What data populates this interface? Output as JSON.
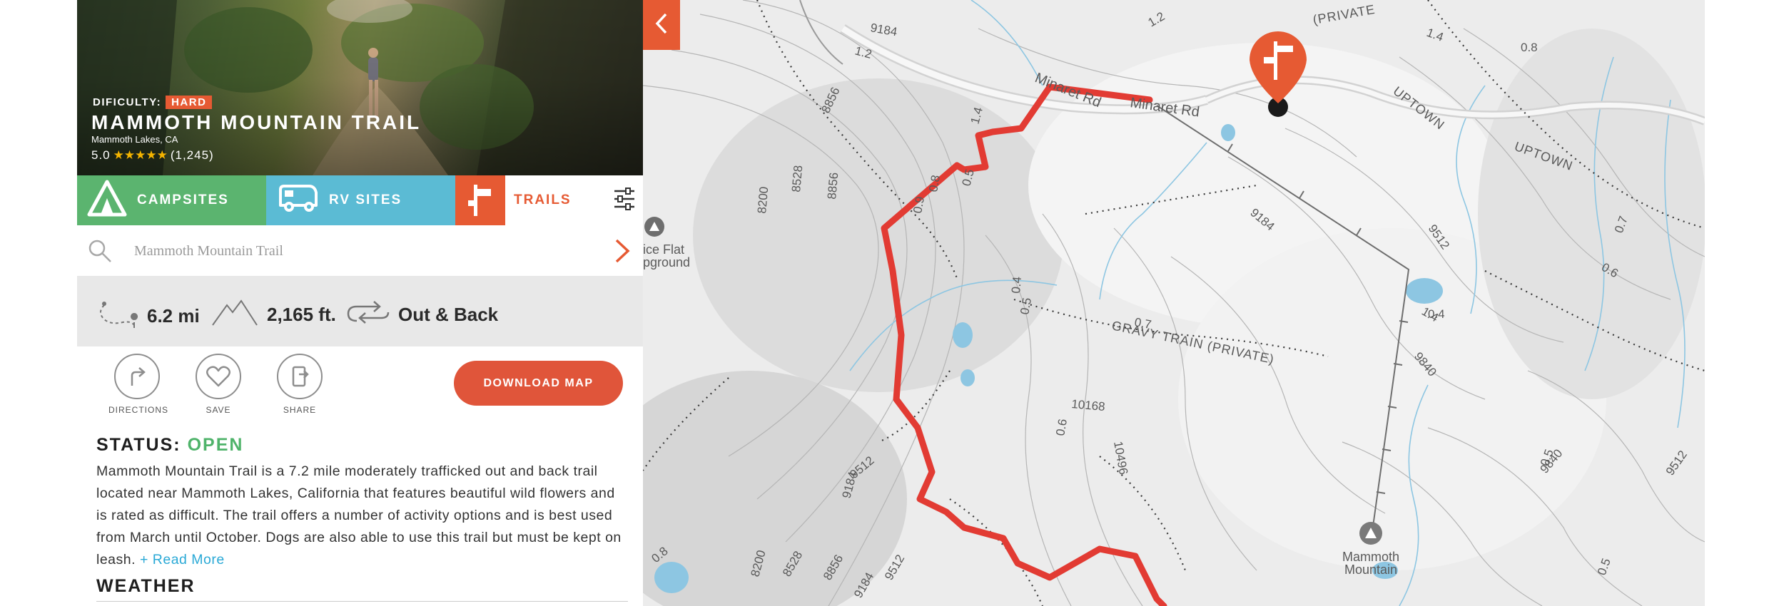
{
  "trail": {
    "difficulty_label": "DIFICULTY:",
    "difficulty_value": "HARD",
    "name": "MAMMOTH MOUNTAIN TRAIL",
    "location": "Mammoth Lakes, CA",
    "rating": "5.0",
    "stars": "★★★★★",
    "rating_count": "(1,245)"
  },
  "tabs": {
    "campsites": "CAMPSITES",
    "rv_sites": "RV SITES",
    "trails": "TRAILS"
  },
  "search": {
    "value": "Mammoth Mountain Trail"
  },
  "stats": {
    "distance": "6.2 mi",
    "elevation": "2,165 ft.",
    "route_type": "Out & Back"
  },
  "actions": {
    "directions": "DIRECTIONS",
    "save": "SAVE",
    "share": "SHARE",
    "download": "DOWNLOAD MAP"
  },
  "status": {
    "label": "STATUS:",
    "value": "OPEN"
  },
  "description": {
    "text": "Mammoth Mountain Trail is a 7.2 mile moderately trafficked out and back trail located near Mammoth Lakes, California that features beautiful wild flowers and is rated as difficult. The trail offers a number of activity options and is best used from March until October. Dogs are also able to use this trail but must be kept on leash.",
    "read_more": "+ Read More"
  },
  "weather": {
    "heading": "WEATHER"
  },
  "map": {
    "labels": {
      "minaret_rd_1": "Minaret Rd",
      "minaret_rd_2": "Minaret Rd",
      "gravy_train": "GRAVY TRAIN (PRIVATE)",
      "uptown_1": "UPTOWN",
      "uptown_2": "UPTOWN",
      "private_top": "(PRIVATE",
      "campground_1": "ice Flat",
      "campground_2": "pground",
      "summit_1": "Mammoth",
      "summit_2": "Mountain"
    },
    "contours": [
      "9184",
      "8856",
      "8528",
      "8856",
      "8200",
      "9512",
      "9184",
      "8200",
      "8528",
      "8856",
      "9184",
      "9512",
      "10168",
      "10496",
      "9840",
      "9840",
      "9512",
      "9512",
      "9184"
    ],
    "distances": [
      "1.2",
      "1.2",
      "1.4",
      "0.8",
      "0.9",
      "0.8",
      "0.5",
      "0.4",
      "0.5",
      "0.7",
      "0.4",
      "0.6",
      "0.6",
      "0.7",
      "0.5",
      "0.5",
      "0.8",
      "1.4",
      "1.4"
    ],
    "colors": {
      "route": "#e23b33",
      "marker": "#e65a33",
      "water": "#8dc6e2"
    }
  }
}
